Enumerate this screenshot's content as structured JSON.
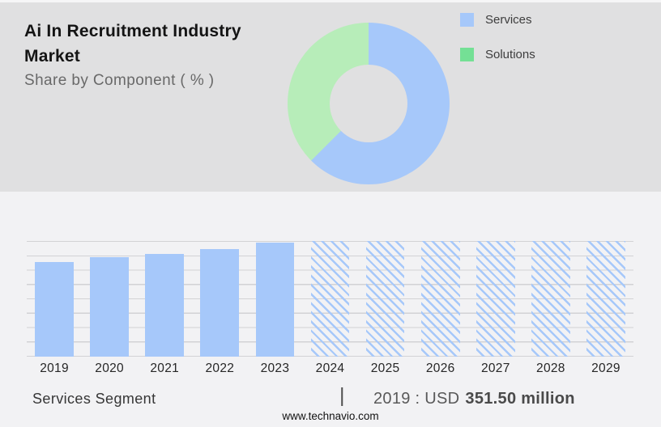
{
  "header": {
    "title": "Ai In Recruitment Industry Market",
    "subtitle": "Share by Component ( % )"
  },
  "legend": {
    "items": [
      {
        "label": "Services",
        "swatch": "blue-square-icon",
        "color": "#a6c8fa"
      },
      {
        "label": "Solutions",
        "swatch": "green-square-icon",
        "color": "#74e095"
      }
    ]
  },
  "chart_data": [
    {
      "type": "pie",
      "donut": true,
      "title": "Share by Component ( % )",
      "labels": [
        "Services",
        "Solutions"
      ],
      "values": [
        62.5,
        37.5
      ],
      "colors": [
        "#a6c8fa",
        "#b7edb9"
      ],
      "start_angle_deg": 0,
      "legend_position": "top-right",
      "note": "no numeric labels shown in image; split estimated from arc angles (Services arc ~225 degrees)"
    },
    {
      "type": "bar",
      "title": "Services Segment",
      "categories": [
        "2019",
        "2020",
        "2021",
        "2022",
        "2023",
        "2024",
        "2025",
        "2026",
        "2027",
        "2028",
        "2029"
      ],
      "series": [
        {
          "name": "Services Segment",
          "unit": "USD million",
          "values": [
            351.5,
            366.6,
            379.7,
            398.7,
            422.9,
            null,
            null,
            null,
            null,
            null,
            null
          ]
        }
      ],
      "bar_height_pct": [
        82.1,
        85.7,
        88.7,
        93.1,
        98.8,
        100,
        100,
        100,
        100,
        100,
        100
      ],
      "hatched": [
        false,
        false,
        false,
        false,
        false,
        true,
        true,
        true,
        true,
        true,
        true
      ],
      "bar_color": "#a6c8fa",
      "xlabel": "",
      "ylabel": "",
      "grid": "horizontal, 9 lines, no y-axis tick labels",
      "annotation": "2019 : USD 351.50 million",
      "note": "only 2019 value is labeled; 2020-2023 estimated from bar heights; 2024-2029 are full-height hatched forecast placeholders"
    }
  ],
  "footer": {
    "segment_label": "Services Segment",
    "separator": "|",
    "value_prefix": "2019 : USD",
    "value_bold": "351.50 million",
    "website": "www.technavio.com"
  },
  "colors": {
    "top_bg": "#e0e0e1",
    "bottom_bg": "#f2f2f4",
    "bar_blue": "#a6c8fa",
    "donut_blue": "#a6c8fa",
    "donut_green": "#b7edb9",
    "legend_green": "#74e095",
    "grid_line": "#d2d2d5"
  }
}
